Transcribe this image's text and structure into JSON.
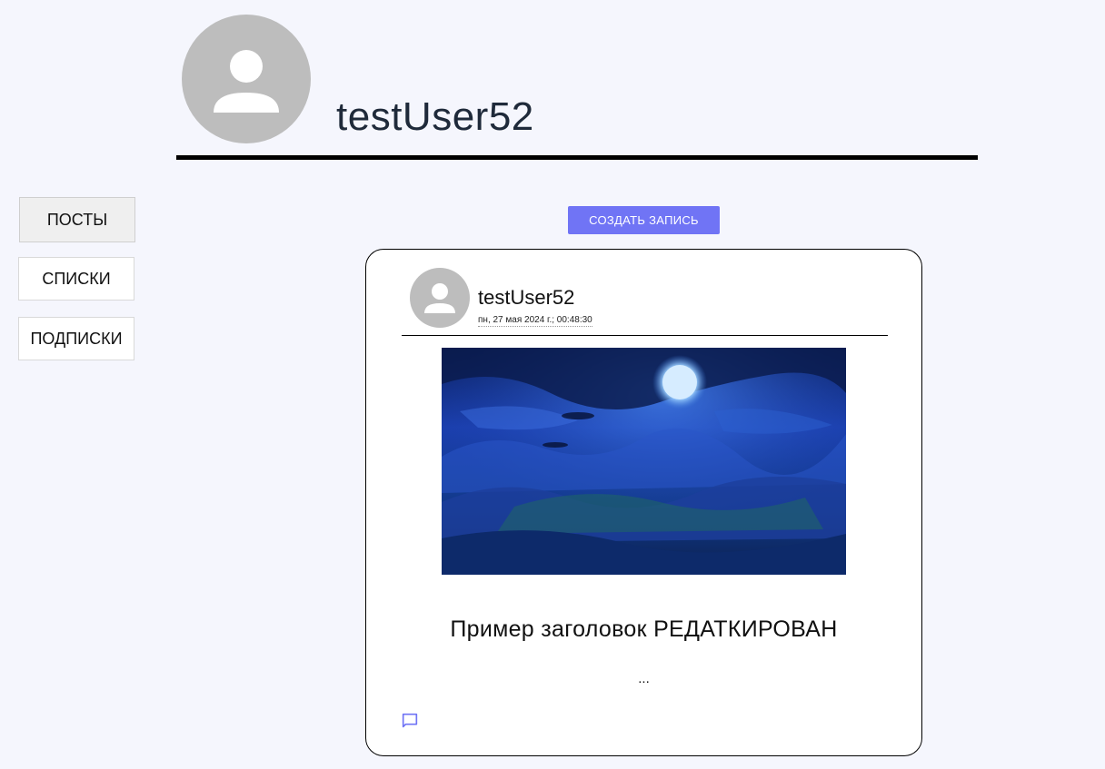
{
  "profile": {
    "username": "testUser52",
    "avatar_icon": "person-icon"
  },
  "nav": {
    "items": [
      {
        "label": "ПОСТЫ",
        "active": true
      },
      {
        "label": "СПИСКИ",
        "active": false
      },
      {
        "label": "ПОДПИСКИ",
        "active": false
      }
    ]
  },
  "actions": {
    "create_label": "СОЗДАТЬ ЗАПИСЬ"
  },
  "post": {
    "author": "testUser52",
    "date": "пн, 27 мая 2024 г.; 00:48:30",
    "title": "Пример заголовок РЕДАТКИРОВАН",
    "excerpt": "...",
    "comment_icon": "comment-icon"
  },
  "colors": {
    "background": "#f5f6fd",
    "accent": "#7074f5",
    "avatar_bg": "#bdbdbd",
    "username_text": "#1f2a3a"
  }
}
